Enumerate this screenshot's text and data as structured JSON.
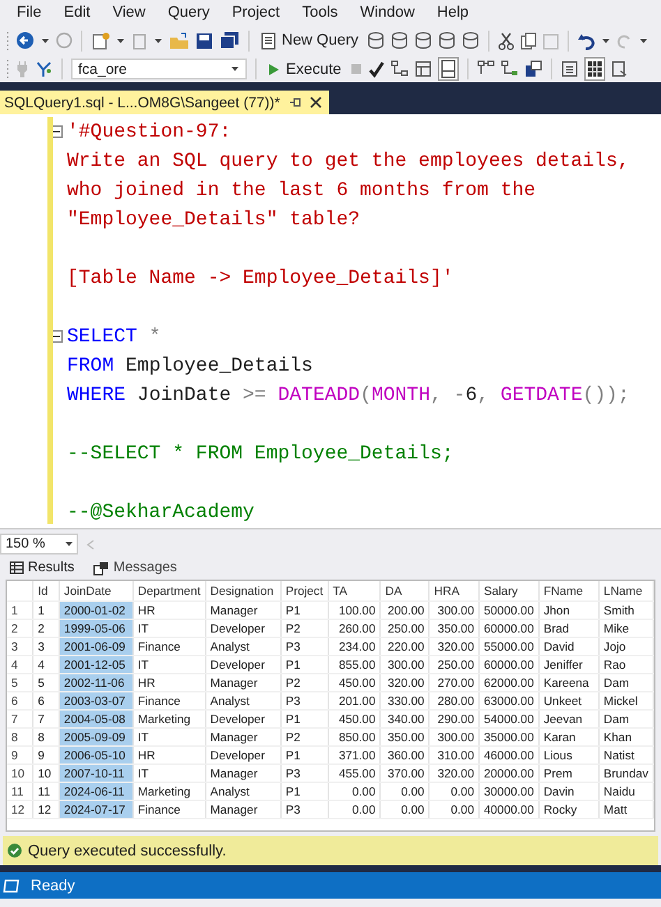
{
  "menu": [
    "File",
    "Edit",
    "View",
    "Query",
    "Project",
    "Tools",
    "Window",
    "Help"
  ],
  "toolbar": {
    "new_query": "New Query",
    "database": "fca_ore",
    "execute": "Execute"
  },
  "tab": {
    "title": "SQLQuery1.sql - L...OM8G\\Sangeet (77))*",
    "selected": true
  },
  "editor": {
    "blocks": [
      [
        {
          "fold": true,
          "segments": [
            {
              "kind": "string",
              "text": "'#Question-97:"
            }
          ]
        },
        {
          "fold": false,
          "segments": [
            {
              "kind": "string",
              "text": "Write an SQL query to get the employees details,"
            }
          ]
        },
        {
          "fold": false,
          "segments": [
            {
              "kind": "string",
              "text": "who joined in the last 6 months from the"
            }
          ]
        },
        {
          "fold": false,
          "segments": [
            {
              "kind": "string",
              "text": "\"Employee_Details\" table?"
            }
          ]
        }
      ],
      [
        {
          "fold": false,
          "segments": [
            {
              "kind": "string",
              "text": "[Table Name -> Employee_Details]'"
            }
          ]
        }
      ],
      [
        {
          "fold": true,
          "segments": [
            {
              "kind": "keyword",
              "text": "SELECT"
            },
            {
              "kind": "operator",
              "text": " *"
            }
          ]
        },
        {
          "fold": false,
          "segments": [
            {
              "kind": "keyword",
              "text": "FROM"
            },
            {
              "kind": "plain",
              "text": " Employee_Details"
            }
          ]
        },
        {
          "fold": false,
          "segments": [
            {
              "kind": "keyword",
              "text": "WHERE"
            },
            {
              "kind": "plain",
              "text": " JoinDate "
            },
            {
              "kind": "operator",
              "text": ">= "
            },
            {
              "kind": "function",
              "text": "DATEADD"
            },
            {
              "kind": "operator",
              "text": "("
            },
            {
              "kind": "function",
              "text": "MONTH"
            },
            {
              "kind": "operator",
              "text": ", -"
            },
            {
              "kind": "plain",
              "text": "6"
            },
            {
              "kind": "operator",
              "text": ", "
            },
            {
              "kind": "function",
              "text": "GETDATE"
            },
            {
              "kind": "operator",
              "text": "());"
            }
          ]
        }
      ],
      [
        {
          "fold": false,
          "segments": [
            {
              "kind": "comment",
              "text": "--SELECT * FROM Employee_Details;"
            }
          ]
        }
      ],
      [
        {
          "fold": false,
          "segments": [
            {
              "kind": "comment",
              "text": "--@SekharAcademy"
            }
          ]
        }
      ]
    ]
  },
  "zoom": "150 %",
  "result_tabs": [
    {
      "label": "Results",
      "selected": true
    },
    {
      "label": "Messages",
      "selected": false
    }
  ],
  "grid": {
    "columns": [
      {
        "label": "Id",
        "selected": false,
        "kind": "text"
      },
      {
        "label": "JoinDate",
        "selected": true,
        "kind": "text"
      },
      {
        "label": "Department",
        "selected": false,
        "kind": "text"
      },
      {
        "label": "Designation",
        "selected": false,
        "kind": "text"
      },
      {
        "label": "Project",
        "selected": false,
        "kind": "text"
      },
      {
        "label": "TA",
        "selected": false,
        "kind": "number"
      },
      {
        "label": "DA",
        "selected": false,
        "kind": "number"
      },
      {
        "label": "HRA",
        "selected": false,
        "kind": "number"
      },
      {
        "label": "Salary",
        "selected": false,
        "kind": "number"
      },
      {
        "label": "FName",
        "selected": false,
        "kind": "text"
      },
      {
        "label": "LName",
        "selected": false,
        "kind": "text"
      }
    ],
    "rows": [
      {
        "number": "1",
        "cells": [
          "1",
          "2000-01-02",
          "HR",
          "Manager",
          "P1",
          "100.00",
          "200.00",
          "300.00",
          "50000.00",
          "Jhon",
          "Smith"
        ]
      },
      {
        "number": "2",
        "cells": [
          "2",
          "1999-05-06",
          "IT",
          "Developer",
          "P2",
          "260.00",
          "250.00",
          "350.00",
          "60000.00",
          "Brad",
          "Mike"
        ]
      },
      {
        "number": "3",
        "cells": [
          "3",
          "2001-06-09",
          "Finance",
          "Analyst",
          "P3",
          "234.00",
          "220.00",
          "320.00",
          "55000.00",
          "David",
          "Jojo"
        ]
      },
      {
        "number": "4",
        "cells": [
          "4",
          "2001-12-05",
          "IT",
          "Developer",
          "P1",
          "855.00",
          "300.00",
          "250.00",
          "60000.00",
          "Jeniffer",
          "Rao"
        ]
      },
      {
        "number": "5",
        "cells": [
          "5",
          "2002-11-06",
          "HR",
          "Manager",
          "P2",
          "450.00",
          "320.00",
          "270.00",
          "62000.00",
          "Kareena",
          "Dam"
        ]
      },
      {
        "number": "6",
        "cells": [
          "6",
          "2003-03-07",
          "Finance",
          "Analyst",
          "P3",
          "201.00",
          "330.00",
          "280.00",
          "63000.00",
          "Unkeet",
          "Mickel"
        ]
      },
      {
        "number": "7",
        "cells": [
          "7",
          "2004-05-08",
          "Marketing",
          "Developer",
          "P1",
          "450.00",
          "340.00",
          "290.00",
          "54000.00",
          "Jeevan",
          "Dam"
        ]
      },
      {
        "number": "8",
        "cells": [
          "8",
          "2005-09-09",
          "IT",
          "Manager",
          "P2",
          "850.00",
          "350.00",
          "300.00",
          "35000.00",
          "Karan",
          "Khan"
        ]
      },
      {
        "number": "9",
        "cells": [
          "9",
          "2006-05-10",
          "HR",
          "Developer",
          "P1",
          "371.00",
          "360.00",
          "310.00",
          "46000.00",
          "Lious",
          "Natist"
        ]
      },
      {
        "number": "10",
        "cells": [
          "10",
          "2007-10-11",
          "IT",
          "Manager",
          "P3",
          "455.00",
          "370.00",
          "320.00",
          "20000.00",
          "Prem",
          "Brundav"
        ]
      },
      {
        "number": "11",
        "cells": [
          "11",
          "2024-06-11",
          "Marketing",
          "Analyst",
          "P1",
          "0.00",
          "0.00",
          "0.00",
          "30000.00",
          "Davin",
          "Naidu"
        ]
      },
      {
        "number": "12",
        "cells": [
          "12",
          "2024-07-17",
          "Finance",
          "Manager",
          "P3",
          "0.00",
          "0.00",
          "0.00",
          "40000.00",
          "Rocky",
          "Matt"
        ]
      }
    ]
  },
  "message": "Query executed successfully.",
  "status": "Ready"
}
